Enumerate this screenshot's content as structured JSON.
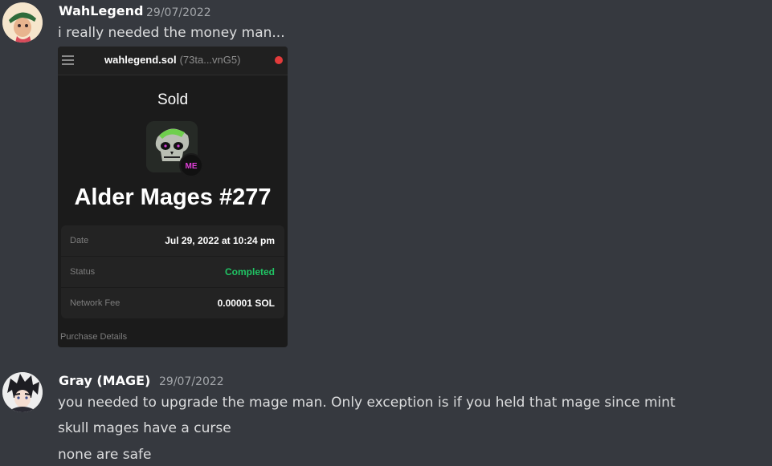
{
  "messages": [
    {
      "author": "WahLegend",
      "timestamp": "29/07/2022",
      "lines": [
        "i really needed the money man..."
      ],
      "attachment": {
        "wallet_name": "wahlegend.sol",
        "wallet_address": "(73ta...vnG5)",
        "status_title": "Sold",
        "nft_name": "Alder Mages #277",
        "badge_text": "ME",
        "details": [
          {
            "label": "Date",
            "value": "Jul 29, 2022 at 10:24 pm"
          },
          {
            "label": "Status",
            "value": "Completed"
          },
          {
            "label": "Network Fee",
            "value": "0.00001 SOL"
          }
        ],
        "footer": "Purchase Details"
      }
    },
    {
      "author": "Gray (MAGE)",
      "timestamp": "29/07/2022",
      "lines": [
        "you needed to upgrade the mage man. Only exception is if you held that mage since mint",
        "skull mages have a curse",
        "none are safe"
      ]
    }
  ],
  "colors": {
    "background": "#36393f",
    "completed_status": "#20c464",
    "notification_dot": "#e33b3b"
  }
}
